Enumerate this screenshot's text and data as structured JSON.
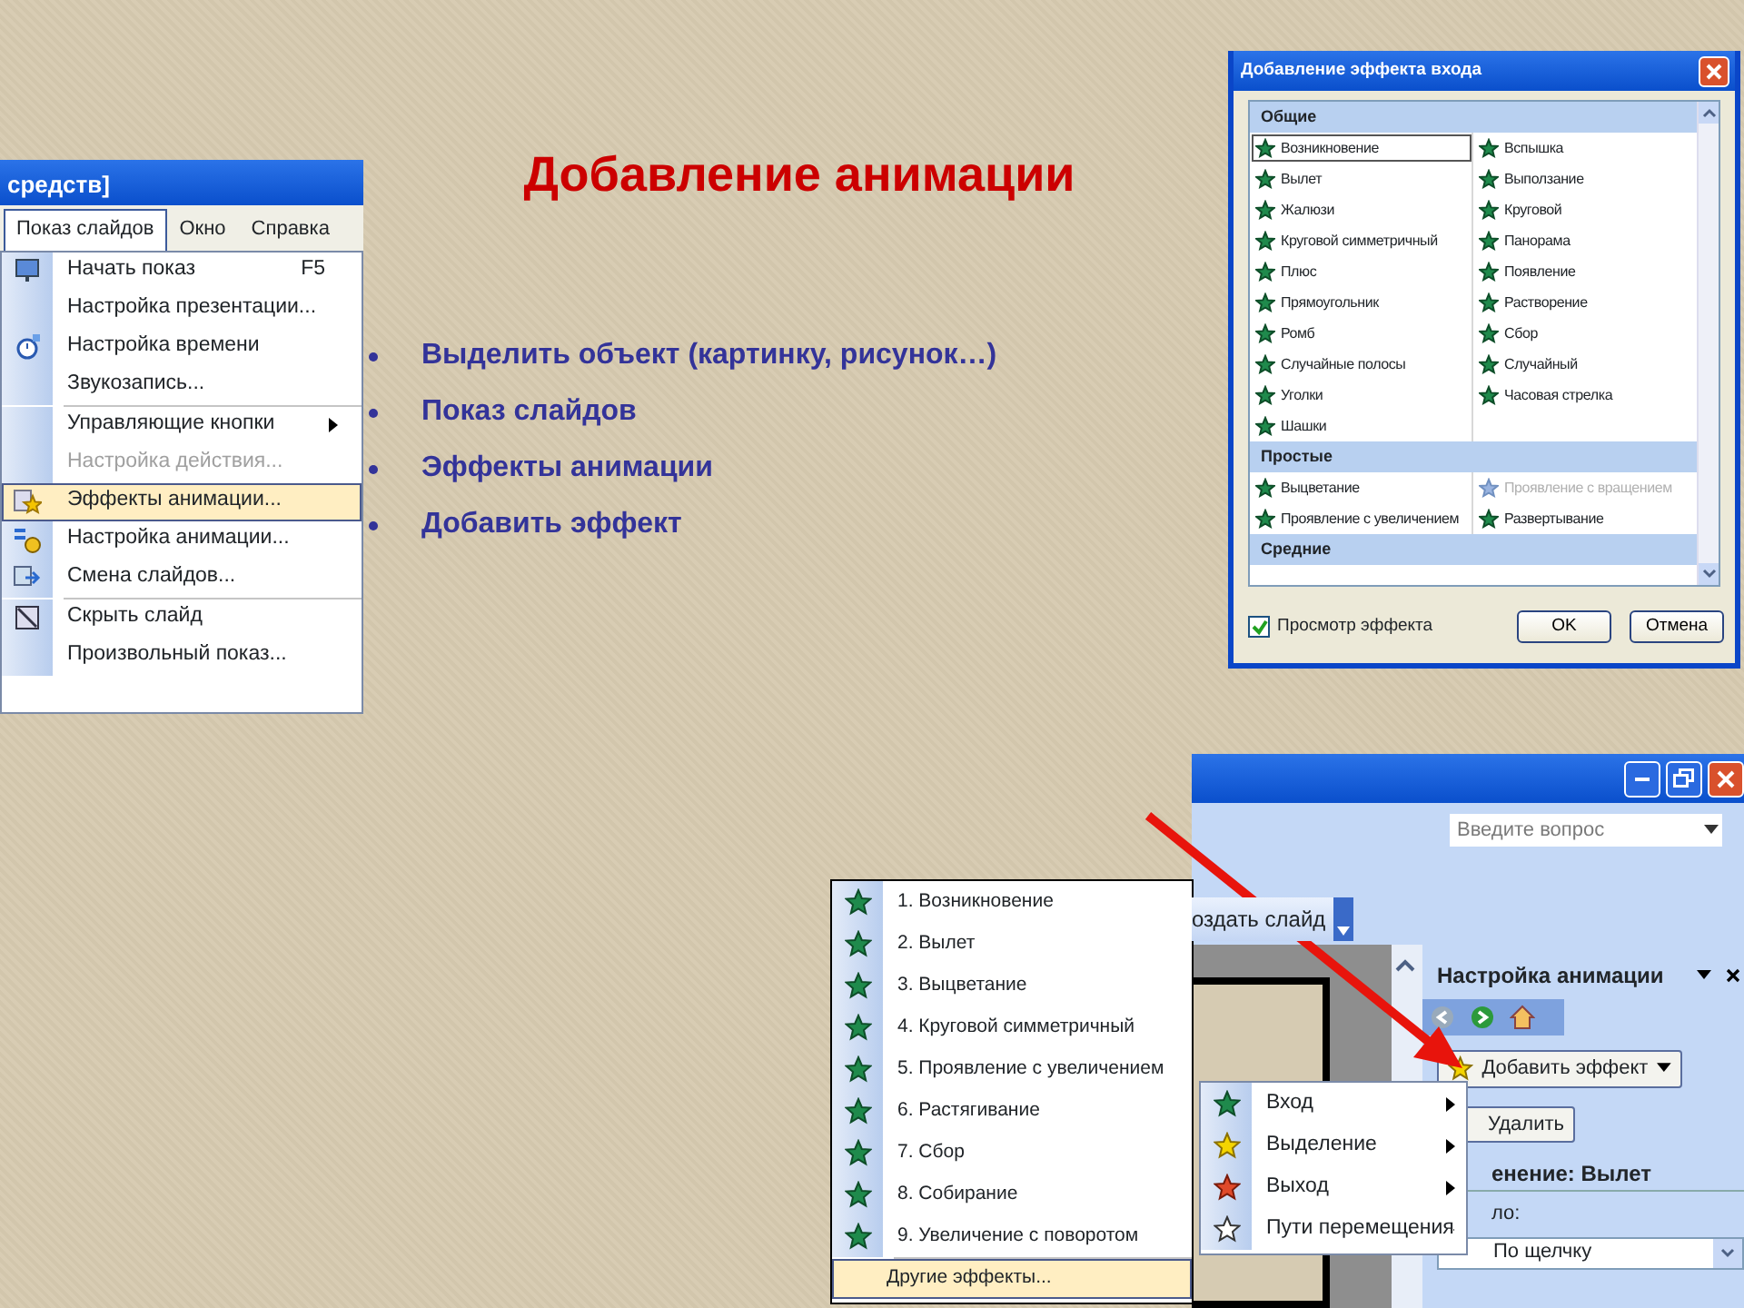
{
  "title": "Добавление анимации",
  "bullets": [
    "Выделить объект (картинку, рисунок…)",
    "Показ слайдов",
    "Эффекты анимации",
    "Добавить эффект"
  ],
  "slide_show_menu": {
    "caption_fragment": "средств]",
    "menubar": [
      {
        "label": "Показ слайдов",
        "selected": true
      },
      {
        "label": "Окно",
        "selected": false
      },
      {
        "label": "Справка",
        "selected": false
      }
    ],
    "items": [
      {
        "label": "Начать показ",
        "shortcut": "F5",
        "kind": "screen",
        "submenu": false,
        "disabled": false,
        "selected": false,
        "separator_before": false
      },
      {
        "label": "Настройка презентации...",
        "kind": "none",
        "submenu": false,
        "disabled": false,
        "selected": false,
        "separator_before": false
      },
      {
        "label": "Настройка времени",
        "kind": "timer",
        "submenu": false,
        "disabled": false,
        "selected": false,
        "separator_before": false
      },
      {
        "label": "Звукозапись...",
        "kind": "none",
        "submenu": false,
        "disabled": false,
        "selected": false,
        "separator_before": false
      },
      {
        "label": "Управляющие кнопки",
        "kind": "none",
        "submenu": true,
        "disabled": false,
        "selected": false,
        "separator_before": true
      },
      {
        "label": "Настройка действия...",
        "kind": "none",
        "submenu": false,
        "disabled": true,
        "selected": false,
        "separator_before": false
      },
      {
        "label": "Эффекты анимации...",
        "kind": "star",
        "submenu": false,
        "disabled": false,
        "selected": true,
        "separator_before": false
      },
      {
        "label": "Настройка анимации...",
        "kind": "animation",
        "submenu": false,
        "disabled": false,
        "selected": false,
        "separator_before": false
      },
      {
        "label": "Смена слайдов...",
        "kind": "transition",
        "submenu": false,
        "disabled": false,
        "selected": false,
        "separator_before": false
      },
      {
        "label": "Скрыть слайд",
        "kind": "hide",
        "submenu": false,
        "disabled": false,
        "selected": false,
        "separator_before": true
      },
      {
        "label": "Произвольный показ...",
        "kind": "none",
        "submenu": false,
        "disabled": false,
        "selected": false,
        "separator_before": false
      }
    ]
  },
  "entrance_dialog": {
    "title": "Добавление эффекта входа",
    "groups": [
      {
        "name": "Общие",
        "items": [
          {
            "label": "Возникновение",
            "selected": true,
            "disabled": false
          },
          {
            "label": "Вспышка",
            "selected": false,
            "disabled": false
          },
          {
            "label": "Вылет",
            "selected": false,
            "disabled": false
          },
          {
            "label": "Выползание",
            "selected": false,
            "disabled": false
          },
          {
            "label": "Жалюзи",
            "selected": false,
            "disabled": false
          },
          {
            "label": "Круговой",
            "selected": false,
            "disabled": false
          },
          {
            "label": "Круговой симметричный",
            "selected": false,
            "disabled": false
          },
          {
            "label": "Панорама",
            "selected": false,
            "disabled": false
          },
          {
            "label": "Плюс",
            "selected": false,
            "disabled": false
          },
          {
            "label": "Появление",
            "selected": false,
            "disabled": false
          },
          {
            "label": "Прямоугольник",
            "selected": false,
            "disabled": false
          },
          {
            "label": "Растворение",
            "selected": false,
            "disabled": false
          },
          {
            "label": "Ромб",
            "selected": false,
            "disabled": false
          },
          {
            "label": "Сбор",
            "selected": false,
            "disabled": false
          },
          {
            "label": "Случайные полосы",
            "selected": false,
            "disabled": false
          },
          {
            "label": "Случайный",
            "selected": false,
            "disabled": false
          },
          {
            "label": "Уголки",
            "selected": false,
            "disabled": false
          },
          {
            "label": "Часовая стрелка",
            "selected": false,
            "disabled": false
          },
          {
            "label": "Шашки",
            "selected": false,
            "disabled": false
          }
        ]
      },
      {
        "name": "Простые",
        "items": [
          {
            "label": "Выцветание",
            "selected": false,
            "disabled": false
          },
          {
            "label": "Проявление с вращением",
            "selected": false,
            "disabled": true
          },
          {
            "label": "Проявление с увеличением",
            "selected": false,
            "disabled": false
          },
          {
            "label": "Развертывание",
            "selected": false,
            "disabled": false
          }
        ]
      },
      {
        "name": "Средние"
      }
    ],
    "preview_checkbox": {
      "label": "Просмотр эффекта",
      "checked": true
    },
    "buttons": [
      "OK",
      "Отмена"
    ]
  },
  "app_window": {
    "question_field": {
      "placeholder": "Введите вопрос"
    },
    "toolbar_button": "оздать слайд",
    "task_pane": {
      "title": "Настройка анимации",
      "add_effect": "Добавить эффект",
      "remove": "Удалить",
      "change_label": "енение: Вылет",
      "start_label": "ло:",
      "start_value": "По щелчку"
    },
    "effect_submenu": [
      {
        "label": "Вход",
        "kind": "entrance"
      },
      {
        "label": "Выделение",
        "kind": "emphasis"
      },
      {
        "label": "Выход",
        "kind": "exit"
      },
      {
        "label": "Пути перемещения",
        "kind": "path"
      }
    ]
  },
  "effects_menu": {
    "items": [
      "1. Возникновение",
      "2. Вылет",
      "3. Выцветание",
      "4. Круговой симметричный",
      "5. Проявление с увеличением",
      "6. Растягивание",
      "7. Сбор",
      "8. Собирание",
      "9. Увеличение с поворотом"
    ],
    "more": {
      "label": "Другие эффекты...",
      "selected": true
    }
  }
}
